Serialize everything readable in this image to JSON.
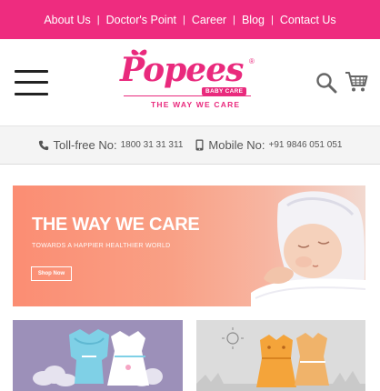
{
  "topnav": {
    "links": [
      "About Us",
      "Doctor's Point",
      "Career",
      "Blog",
      "Contact Us"
    ],
    "separator": "|"
  },
  "brand": {
    "name": "Popees",
    "sub": "BABY CARE",
    "tagline": "THE WAY WE CARE",
    "registered": "®"
  },
  "contact": {
    "tollfree_label": "Toll-free No:",
    "tollfree_number": "1800 31 31 311",
    "mobile_label": "Mobile No:",
    "mobile_number": "+91 9846 051 051"
  },
  "banner": {
    "title": "THE WAY WE CARE",
    "subtitle": "TOWARDS A HAPPIER HEALTHIER WORLD",
    "cta": "Shop Now"
  },
  "colors": {
    "brand_pink": "#ee2c7f",
    "banner_orange": "#fb8d73",
    "tile_purple": "#9c90b9",
    "tile_grey": "#dcdcdc"
  },
  "icons": [
    "menu-icon",
    "search-icon",
    "cart-icon",
    "phone-icon",
    "mobile-icon"
  ]
}
